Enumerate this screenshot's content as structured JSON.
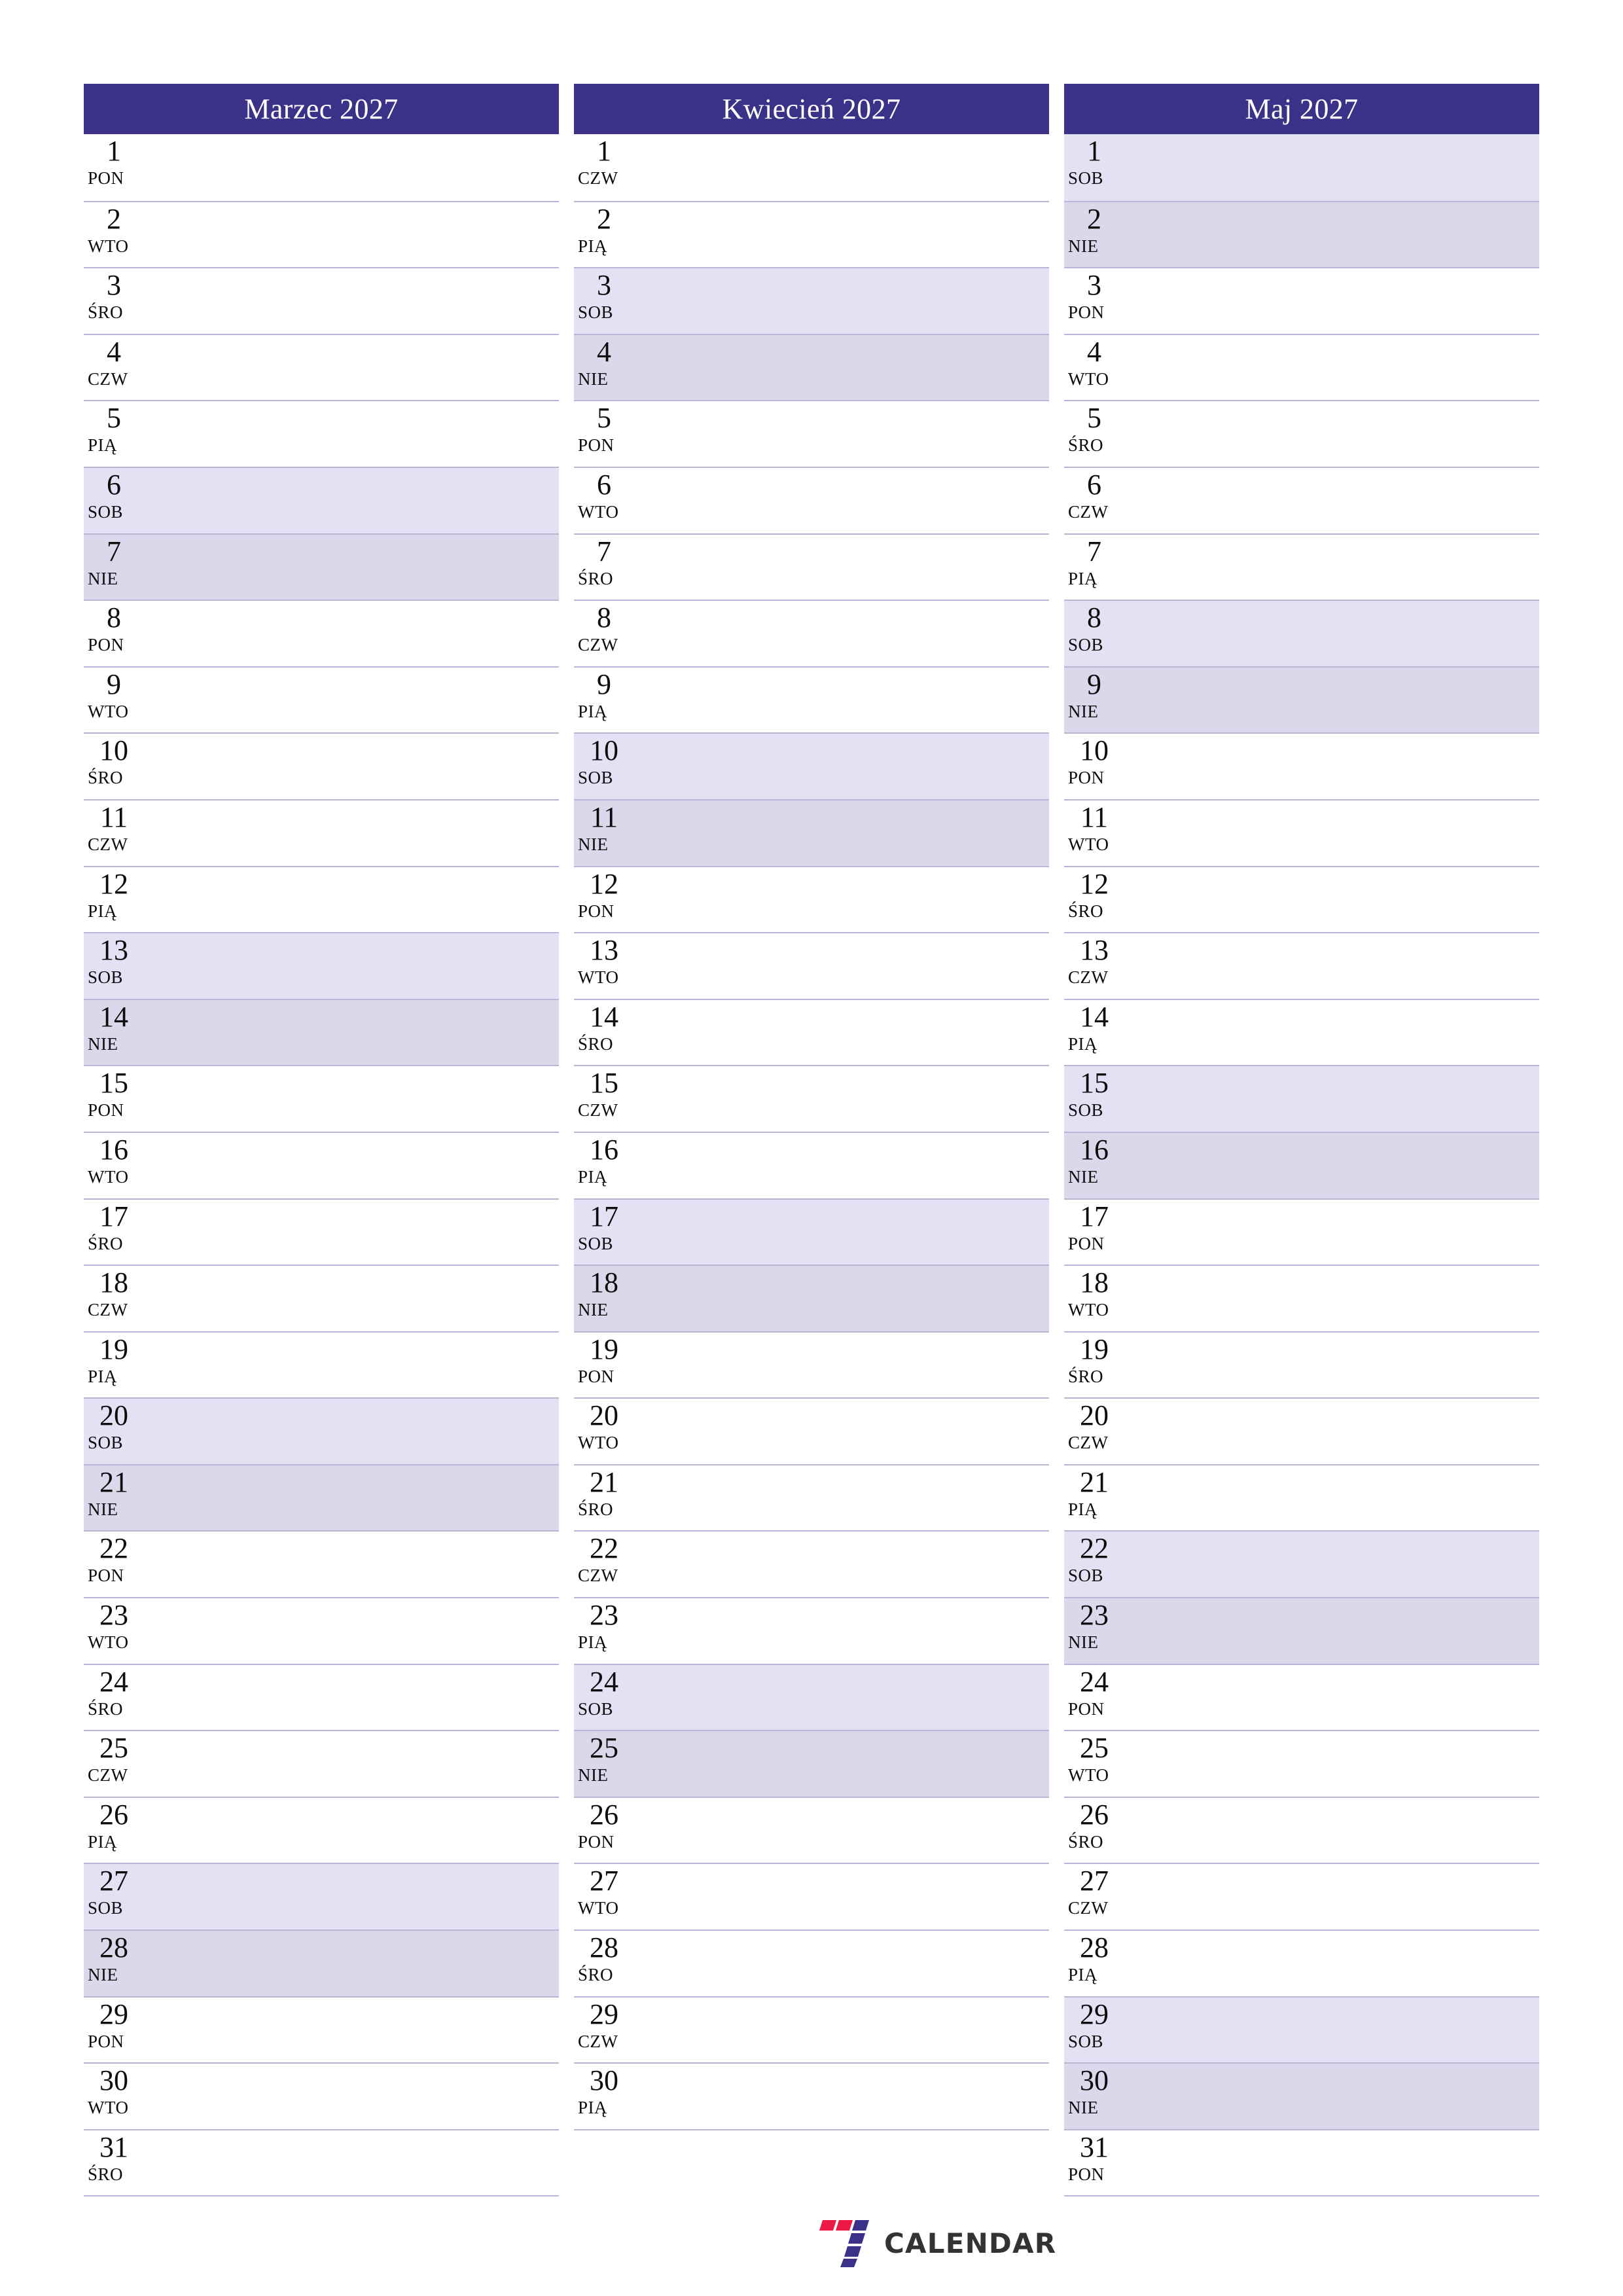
{
  "page": {
    "background": "#ffffff",
    "accent": "#3b3189",
    "saturday_color": "#e2e2f4",
    "sunday_color": "#dcd7eb",
    "divider_color": "#b7b5d8"
  },
  "brand": {
    "wordmark": "CALENDAR",
    "mark_name": "seven-logo-icon",
    "mark_colors": [
      "#ed1846",
      "#3b3189"
    ]
  },
  "months": [
    {
      "title": "Marzec 2027",
      "days": [
        {
          "num": "1",
          "abbr": "PON",
          "type": "weekday"
        },
        {
          "num": "2",
          "abbr": "WTO",
          "type": "weekday"
        },
        {
          "num": "3",
          "abbr": "ŚRO",
          "type": "weekday"
        },
        {
          "num": "4",
          "abbr": "CZW",
          "type": "weekday"
        },
        {
          "num": "5",
          "abbr": "PIĄ",
          "type": "weekday"
        },
        {
          "num": "6",
          "abbr": "SOB",
          "type": "sat"
        },
        {
          "num": "7",
          "abbr": "NIE",
          "type": "sun"
        },
        {
          "num": "8",
          "abbr": "PON",
          "type": "weekday"
        },
        {
          "num": "9",
          "abbr": "WTO",
          "type": "weekday"
        },
        {
          "num": "10",
          "abbr": "ŚRO",
          "type": "weekday"
        },
        {
          "num": "11",
          "abbr": "CZW",
          "type": "weekday"
        },
        {
          "num": "12",
          "abbr": "PIĄ",
          "type": "weekday"
        },
        {
          "num": "13",
          "abbr": "SOB",
          "type": "sat"
        },
        {
          "num": "14",
          "abbr": "NIE",
          "type": "sun"
        },
        {
          "num": "15",
          "abbr": "PON",
          "type": "weekday"
        },
        {
          "num": "16",
          "abbr": "WTO",
          "type": "weekday"
        },
        {
          "num": "17",
          "abbr": "ŚRO",
          "type": "weekday"
        },
        {
          "num": "18",
          "abbr": "CZW",
          "type": "weekday"
        },
        {
          "num": "19",
          "abbr": "PIĄ",
          "type": "weekday"
        },
        {
          "num": "20",
          "abbr": "SOB",
          "type": "sat"
        },
        {
          "num": "21",
          "abbr": "NIE",
          "type": "sun"
        },
        {
          "num": "22",
          "abbr": "PON",
          "type": "weekday"
        },
        {
          "num": "23",
          "abbr": "WTO",
          "type": "weekday"
        },
        {
          "num": "24",
          "abbr": "ŚRO",
          "type": "weekday"
        },
        {
          "num": "25",
          "abbr": "CZW",
          "type": "weekday"
        },
        {
          "num": "26",
          "abbr": "PIĄ",
          "type": "weekday"
        },
        {
          "num": "27",
          "abbr": "SOB",
          "type": "sat"
        },
        {
          "num": "28",
          "abbr": "NIE",
          "type": "sun"
        },
        {
          "num": "29",
          "abbr": "PON",
          "type": "weekday"
        },
        {
          "num": "30",
          "abbr": "WTO",
          "type": "weekday"
        },
        {
          "num": "31",
          "abbr": "ŚRO",
          "type": "weekday"
        }
      ]
    },
    {
      "title": "Kwiecień 2027",
      "days": [
        {
          "num": "1",
          "abbr": "CZW",
          "type": "weekday"
        },
        {
          "num": "2",
          "abbr": "PIĄ",
          "type": "weekday"
        },
        {
          "num": "3",
          "abbr": "SOB",
          "type": "sat"
        },
        {
          "num": "4",
          "abbr": "NIE",
          "type": "sun"
        },
        {
          "num": "5",
          "abbr": "PON",
          "type": "weekday"
        },
        {
          "num": "6",
          "abbr": "WTO",
          "type": "weekday"
        },
        {
          "num": "7",
          "abbr": "ŚRO",
          "type": "weekday"
        },
        {
          "num": "8",
          "abbr": "CZW",
          "type": "weekday"
        },
        {
          "num": "9",
          "abbr": "PIĄ",
          "type": "weekday"
        },
        {
          "num": "10",
          "abbr": "SOB",
          "type": "sat"
        },
        {
          "num": "11",
          "abbr": "NIE",
          "type": "sun"
        },
        {
          "num": "12",
          "abbr": "PON",
          "type": "weekday"
        },
        {
          "num": "13",
          "abbr": "WTO",
          "type": "weekday"
        },
        {
          "num": "14",
          "abbr": "ŚRO",
          "type": "weekday"
        },
        {
          "num": "15",
          "abbr": "CZW",
          "type": "weekday"
        },
        {
          "num": "16",
          "abbr": "PIĄ",
          "type": "weekday"
        },
        {
          "num": "17",
          "abbr": "SOB",
          "type": "sat"
        },
        {
          "num": "18",
          "abbr": "NIE",
          "type": "sun"
        },
        {
          "num": "19",
          "abbr": "PON",
          "type": "weekday"
        },
        {
          "num": "20",
          "abbr": "WTO",
          "type": "weekday"
        },
        {
          "num": "21",
          "abbr": "ŚRO",
          "type": "weekday"
        },
        {
          "num": "22",
          "abbr": "CZW",
          "type": "weekday"
        },
        {
          "num": "23",
          "abbr": "PIĄ",
          "type": "weekday"
        },
        {
          "num": "24",
          "abbr": "SOB",
          "type": "sat"
        },
        {
          "num": "25",
          "abbr": "NIE",
          "type": "sun"
        },
        {
          "num": "26",
          "abbr": "PON",
          "type": "weekday"
        },
        {
          "num": "27",
          "abbr": "WTO",
          "type": "weekday"
        },
        {
          "num": "28",
          "abbr": "ŚRO",
          "type": "weekday"
        },
        {
          "num": "29",
          "abbr": "CZW",
          "type": "weekday"
        },
        {
          "num": "30",
          "abbr": "PIĄ",
          "type": "weekday"
        }
      ]
    },
    {
      "title": "Maj 2027",
      "days": [
        {
          "num": "1",
          "abbr": "SOB",
          "type": "sat"
        },
        {
          "num": "2",
          "abbr": "NIE",
          "type": "sun"
        },
        {
          "num": "3",
          "abbr": "PON",
          "type": "weekday"
        },
        {
          "num": "4",
          "abbr": "WTO",
          "type": "weekday"
        },
        {
          "num": "5",
          "abbr": "ŚRO",
          "type": "weekday"
        },
        {
          "num": "6",
          "abbr": "CZW",
          "type": "weekday"
        },
        {
          "num": "7",
          "abbr": "PIĄ",
          "type": "weekday"
        },
        {
          "num": "8",
          "abbr": "SOB",
          "type": "sat"
        },
        {
          "num": "9",
          "abbr": "NIE",
          "type": "sun"
        },
        {
          "num": "10",
          "abbr": "PON",
          "type": "weekday"
        },
        {
          "num": "11",
          "abbr": "WTO",
          "type": "weekday"
        },
        {
          "num": "12",
          "abbr": "ŚRO",
          "type": "weekday"
        },
        {
          "num": "13",
          "abbr": "CZW",
          "type": "weekday"
        },
        {
          "num": "14",
          "abbr": "PIĄ",
          "type": "weekday"
        },
        {
          "num": "15",
          "abbr": "SOB",
          "type": "sat"
        },
        {
          "num": "16",
          "abbr": "NIE",
          "type": "sun"
        },
        {
          "num": "17",
          "abbr": "PON",
          "type": "weekday"
        },
        {
          "num": "18",
          "abbr": "WTO",
          "type": "weekday"
        },
        {
          "num": "19",
          "abbr": "ŚRO",
          "type": "weekday"
        },
        {
          "num": "20",
          "abbr": "CZW",
          "type": "weekday"
        },
        {
          "num": "21",
          "abbr": "PIĄ",
          "type": "weekday"
        },
        {
          "num": "22",
          "abbr": "SOB",
          "type": "sat"
        },
        {
          "num": "23",
          "abbr": "NIE",
          "type": "sun"
        },
        {
          "num": "24",
          "abbr": "PON",
          "type": "weekday"
        },
        {
          "num": "25",
          "abbr": "WTO",
          "type": "weekday"
        },
        {
          "num": "26",
          "abbr": "ŚRO",
          "type": "weekday"
        },
        {
          "num": "27",
          "abbr": "CZW",
          "type": "weekday"
        },
        {
          "num": "28",
          "abbr": "PIĄ",
          "type": "weekday"
        },
        {
          "num": "29",
          "abbr": "SOB",
          "type": "sat"
        },
        {
          "num": "30",
          "abbr": "NIE",
          "type": "sun"
        },
        {
          "num": "31",
          "abbr": "PON",
          "type": "weekday"
        }
      ]
    }
  ]
}
